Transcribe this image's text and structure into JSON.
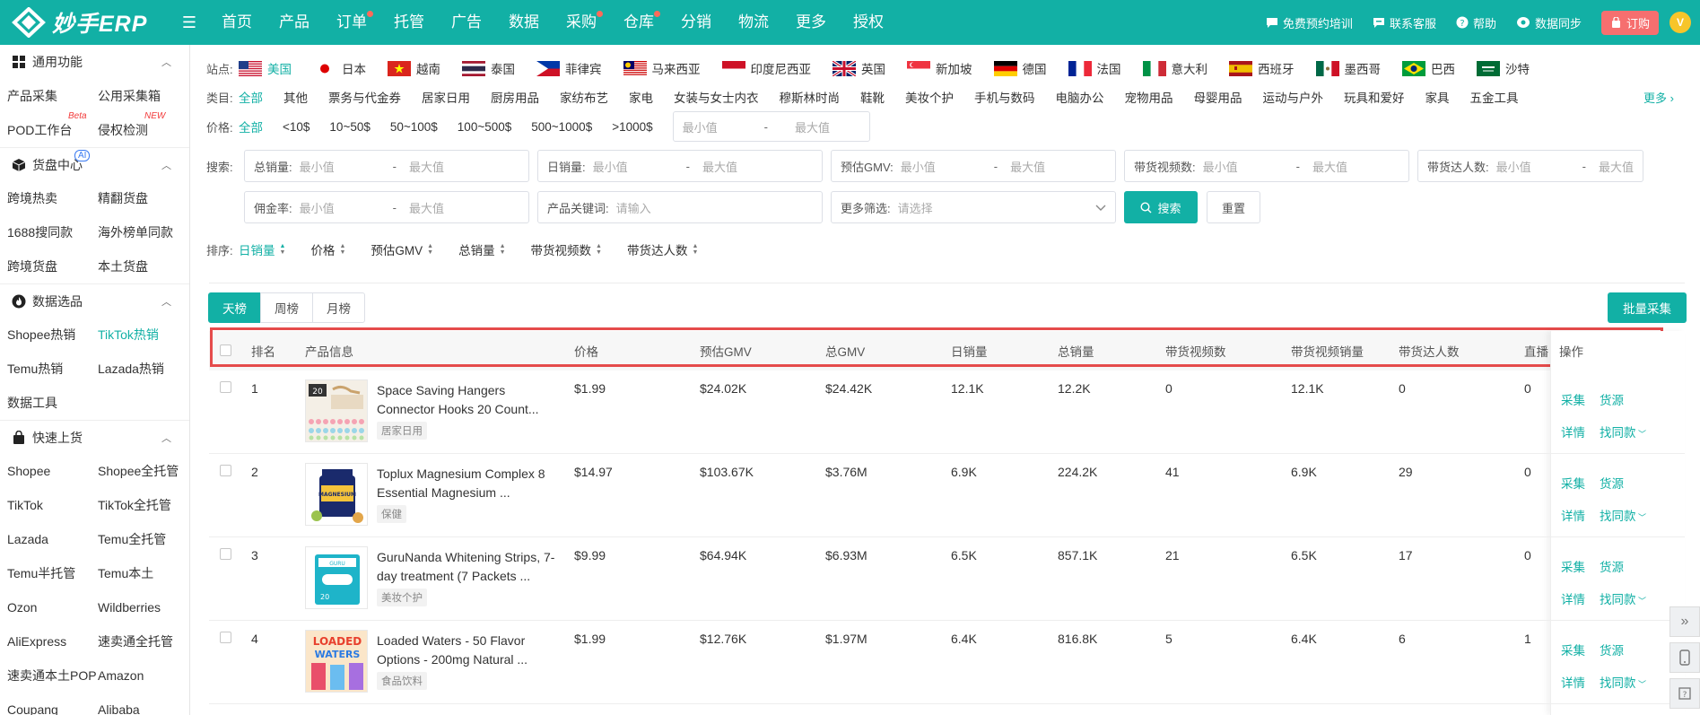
{
  "app": {
    "logo_text": "妙手ERP"
  },
  "nav": [
    {
      "label": "首页",
      "dot": false
    },
    {
      "label": "产品",
      "dot": false
    },
    {
      "label": "订单",
      "dot": true
    },
    {
      "label": "托管",
      "dot": false
    },
    {
      "label": "广告",
      "dot": false
    },
    {
      "label": "数据",
      "dot": false
    },
    {
      "label": "采购",
      "dot": true
    },
    {
      "label": "仓库",
      "dot": true
    },
    {
      "label": "分销",
      "dot": false
    },
    {
      "label": "物流",
      "dot": false
    },
    {
      "label": "更多",
      "dot": false
    },
    {
      "label": "授权",
      "dot": false
    }
  ],
  "tools": {
    "training": "免费预约培训",
    "support": "联系客服",
    "help": "帮助",
    "sync": "数据同步",
    "order": "订购",
    "avatar": "V"
  },
  "sidebar": {
    "sections": [
      {
        "title": "通用功能",
        "icon": "grid-icon",
        "items": [
          {
            "label": "产品采集"
          },
          {
            "label": "公用采集箱"
          },
          {
            "label": "POD工作台",
            "sup": "Beta"
          },
          {
            "label": "侵权检测",
            "sup": "NEW"
          }
        ]
      },
      {
        "title": "货盘中心",
        "icon": "cube-icon",
        "badge": "AI",
        "items": [
          {
            "label": "跨境热卖"
          },
          {
            "label": "精翻货盘"
          },
          {
            "label": "1688搜同款"
          },
          {
            "label": "海外榜单同款"
          },
          {
            "label": "跨境货盘"
          },
          {
            "label": "本土货盘"
          }
        ]
      },
      {
        "title": "数据选品",
        "icon": "fire-icon",
        "items": [
          {
            "label": "Shopee热销"
          },
          {
            "label": "TikTok热销",
            "active": true
          },
          {
            "label": "Temu热销"
          },
          {
            "label": "Lazada热销"
          },
          {
            "label": "数据工具"
          }
        ]
      },
      {
        "title": "快速上货",
        "icon": "bag-icon",
        "items": [
          {
            "label": "Shopee"
          },
          {
            "label": "Shopee全托管"
          },
          {
            "label": "TikTok"
          },
          {
            "label": "TikTok全托管"
          },
          {
            "label": "Lazada"
          },
          {
            "label": "Temu全托管"
          },
          {
            "label": "Temu半托管"
          },
          {
            "label": "Temu本土"
          },
          {
            "label": "Ozon"
          },
          {
            "label": "Wildberries"
          },
          {
            "label": "AliExpress"
          },
          {
            "label": "速卖通全托管"
          },
          {
            "label": "速卖通本土POP"
          },
          {
            "label": "Amazon"
          },
          {
            "label": "Coupang"
          },
          {
            "label": "Alibaba"
          }
        ]
      }
    ]
  },
  "filters": {
    "site_label": "站点:",
    "sites": [
      {
        "label": "美国",
        "flag": "us",
        "active": true
      },
      {
        "label": "日本",
        "flag": "jp"
      },
      {
        "label": "越南",
        "flag": "vn"
      },
      {
        "label": "泰国",
        "flag": "th"
      },
      {
        "label": "菲律宾",
        "flag": "ph"
      },
      {
        "label": "马来西亚",
        "flag": "my"
      },
      {
        "label": "印度尼西亚",
        "flag": "id"
      },
      {
        "label": "英国",
        "flag": "gb"
      },
      {
        "label": "新加坡",
        "flag": "sg"
      },
      {
        "label": "德国",
        "flag": "de"
      },
      {
        "label": "法国",
        "flag": "fr"
      },
      {
        "label": "意大利",
        "flag": "it"
      },
      {
        "label": "西班牙",
        "flag": "es"
      },
      {
        "label": "墨西哥",
        "flag": "mx"
      },
      {
        "label": "巴西",
        "flag": "br"
      },
      {
        "label": "沙特",
        "flag": "sa"
      }
    ],
    "category_label": "类目:",
    "categories": [
      "全部",
      "其他",
      "票务与代金券",
      "居家日用",
      "厨房用品",
      "家纺布艺",
      "家电",
      "女装与女士内衣",
      "穆斯林时尚",
      "鞋靴",
      "美妆个护",
      "手机与数码",
      "电脑办公",
      "宠物用品",
      "母婴用品",
      "运动与户外",
      "玩具和爱好",
      "家具",
      "五金工具"
    ],
    "more": "更多",
    "price_label": "价格:",
    "prices": [
      "全部",
      "<10$",
      "10~50$",
      "50~100$",
      "100~500$",
      "500~1000$",
      ">1000$"
    ],
    "min_placeholder": "最小值",
    "max_placeholder": "最大值",
    "dash": "-",
    "search_label": "搜索:",
    "search_ranges": [
      "总销量:",
      "日销量:",
      "预估GMV:",
      "带货视频数:",
      "带货达人数:",
      "佣金率:"
    ],
    "keyword_label": "产品关键词:",
    "keyword_placeholder": "请输入",
    "more_filter_label": "更多筛选:",
    "more_filter_placeholder": "请选择",
    "search_btn": "搜索",
    "reset_btn": "重置",
    "sort_label": "排序:",
    "sorts": [
      "日销量",
      "价格",
      "预估GMV",
      "总销量",
      "带货视频数",
      "带货达人数"
    ]
  },
  "tabs": [
    "天榜",
    "周榜",
    "月榜"
  ],
  "batch_btn": "批量采集",
  "table": {
    "headers": [
      "排名",
      "产品信息",
      "价格",
      "预估GMV",
      "总GMV",
      "日销量",
      "总销量",
      "带货视频数",
      "带货视频销量",
      "带货达人数",
      "直播",
      "操作"
    ],
    "op_labels": {
      "collect": "采集",
      "source": "货源",
      "detail": "详情",
      "similar": "找同款"
    },
    "rows": [
      {
        "rank": "1",
        "title": "Space Saving Hangers Connector Hooks 20 Count...",
        "tag": "居家日用",
        "price": "$1.99",
        "est_gmv": "$24.02K",
        "total_gmv": "$24.42K",
        "daily_sales": "12.1K",
        "total_sales": "12.2K",
        "videos": "0",
        "video_sales": "12.1K",
        "creators": "0",
        "live": "0"
      },
      {
        "rank": "2",
        "title": "Toplux Magnesium Complex 8 Essential Magnesium ...",
        "tag": "保健",
        "price": "$14.97",
        "est_gmv": "$103.67K",
        "total_gmv": "$3.76M",
        "daily_sales": "6.9K",
        "total_sales": "224.2K",
        "videos": "41",
        "video_sales": "6.9K",
        "creators": "29",
        "live": "0"
      },
      {
        "rank": "3",
        "title": "GuruNanda Whitening Strips, 7-day treatment (7 Packets ...",
        "tag": "美妆个护",
        "price": "$9.99",
        "est_gmv": "$64.94K",
        "total_gmv": "$6.93M",
        "daily_sales": "6.5K",
        "total_sales": "857.1K",
        "videos": "21",
        "video_sales": "6.5K",
        "creators": "17",
        "live": "0"
      },
      {
        "rank": "4",
        "title": "Loaded Waters - 50 Flavor Options - 200mg Natural ...",
        "tag": "食品饮料",
        "price": "$1.99",
        "est_gmv": "$12.76K",
        "total_gmv": "$1.97M",
        "daily_sales": "6.4K",
        "total_sales": "816.8K",
        "videos": "5",
        "video_sales": "6.4K",
        "creators": "6",
        "live": "1"
      }
    ]
  },
  "colors": {
    "brand": "#12b0a5",
    "highlight": "#e54b4b",
    "order": "#f66f6f"
  }
}
